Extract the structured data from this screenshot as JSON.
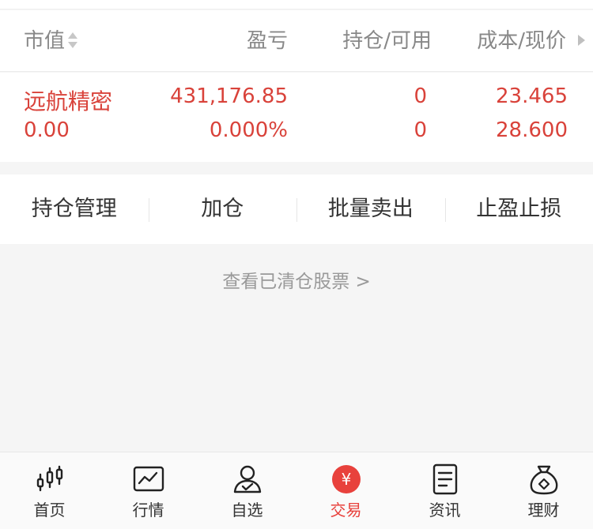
{
  "header": {
    "market_value": "市值",
    "profit_loss": "盈亏",
    "position_available": "持仓/可用",
    "cost_price": "成本/现价"
  },
  "holding": {
    "name": "远航精密",
    "market_value": "0.00",
    "profit_loss": "431,176.85",
    "profit_loss_pct": "0.000%",
    "position": "0",
    "available": "0",
    "cost": "23.465",
    "price": "28.600"
  },
  "actions": {
    "manage": "持仓管理",
    "add": "加仓",
    "batch_sell": "批量卖出",
    "stop": "止盈止损"
  },
  "cleared_link": "查看已清仓股票 >",
  "tabs": {
    "home": "首页",
    "market": "行情",
    "watchlist": "自选",
    "trade": "交易",
    "news": "资讯",
    "wealth": "理财",
    "trade_symbol": "¥"
  },
  "colors": {
    "accent": "#e8413c",
    "value_red": "#d9423a"
  }
}
